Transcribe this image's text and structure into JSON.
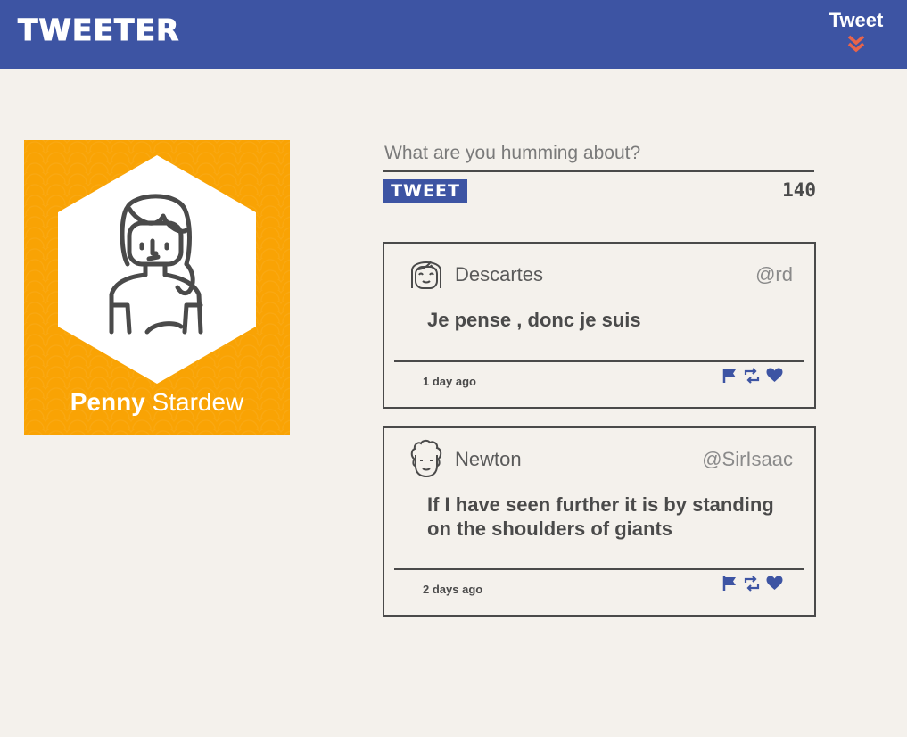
{
  "header": {
    "logo": "TWEETER",
    "nav_tweet_label": "Tweet",
    "brand_color": "#3d54a3",
    "chevron_color": "#e8644a"
  },
  "profile": {
    "first_name": "Penny",
    "last_name": "Stardew",
    "card_color": "#f9a304"
  },
  "compose": {
    "placeholder": "What are you humming about?",
    "value": "",
    "button_label": "TWEET",
    "char_count": "140"
  },
  "tweets": [
    {
      "author": "Descartes",
      "handle": "@rd",
      "text": "Je pense , donc je suis",
      "time": "1 day ago",
      "avatar_icon": "girl-avatar-icon"
    },
    {
      "author": "Newton",
      "handle": "@SirIsaac",
      "text": "If I have seen further it is by standing on the shoulders of giants",
      "time": "2 days ago",
      "avatar_icon": "curly-hair-avatar-icon"
    }
  ],
  "actions": [
    "flag-icon",
    "retweet-icon",
    "heart-icon"
  ]
}
